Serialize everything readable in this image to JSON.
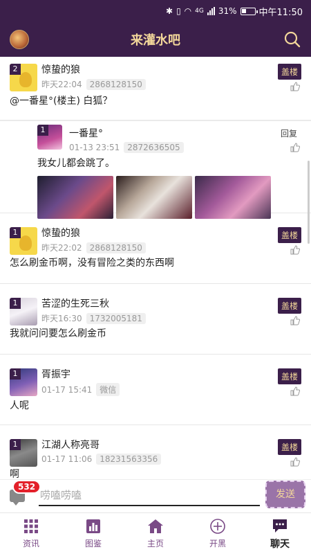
{
  "status_bar": {
    "time": "中午11:50",
    "battery": "31%",
    "network": "4G"
  },
  "header": {
    "title": "来灌水吧"
  },
  "posts": [
    {
      "level": "2",
      "name": "惊蛰的狼",
      "time": "昨天22:04",
      "contact": "2868128150",
      "action": "盖楼",
      "content": "@一番星°(楼主) 白狐？"
    },
    {
      "level": "1",
      "name": "一番星°",
      "time": "01-13 23:51",
      "contact": "2872636505",
      "action": "回复",
      "content": "我女儿都会跳了。"
    },
    {
      "level": "1",
      "name": "惊蛰的狼",
      "time": "昨天22:02",
      "contact": "2868128150",
      "action": "盖楼",
      "content": "怎么刷金币啊，没有冒险之类的东西啊"
    },
    {
      "level": "1",
      "name": "苦涩的生死三秋",
      "time": "昨天16:30",
      "contact": "1732005181",
      "action": "盖楼",
      "content": "我就问问要怎么刷金币"
    },
    {
      "level": "1",
      "name": "胥振宇",
      "time": "01-17 15:41",
      "contact": "微信",
      "action": "盖楼",
      "content": "人呢"
    },
    {
      "level": "1",
      "name": "江湖人称亮哥",
      "time": "01-17 11:06",
      "contact": "18231563356",
      "action": "盖楼",
      "content": "啊"
    }
  ],
  "composer": {
    "badge_count": "532",
    "placeholder": "唠嗑唠嗑",
    "send_label": "发送"
  },
  "bottom_nav": {
    "items": [
      {
        "label": "资讯",
        "icon": "grid-icon"
      },
      {
        "label": "图鉴",
        "icon": "chart-icon"
      },
      {
        "label": "主页",
        "icon": "home-icon"
      },
      {
        "label": "开黑",
        "icon": "plus-circle-icon"
      },
      {
        "label": "聊天",
        "icon": "chat-icon"
      }
    ],
    "active": "聊天"
  },
  "colors": {
    "primary": "#3b1f4a",
    "accent": "#f3d79a",
    "badge": "#e3202a",
    "nav_text": "#7a4a86"
  }
}
